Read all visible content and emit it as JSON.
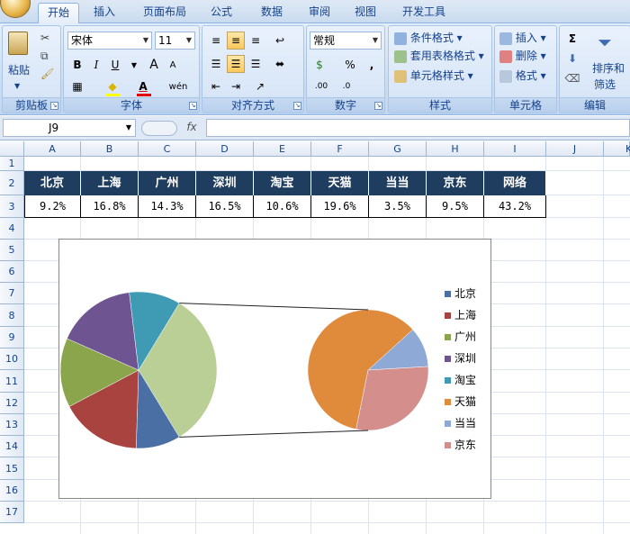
{
  "ribbon_tabs": [
    "开始",
    "插入",
    "页面布局",
    "公式",
    "数据",
    "审阅",
    "视图",
    "开发工具"
  ],
  "active_tab": "开始",
  "groups": {
    "clipboard": {
      "label": "剪贴板",
      "paste": "粘贴"
    },
    "font": {
      "label": "字体",
      "font_name": "宋体",
      "font_size": "11",
      "bold": "B",
      "italic": "I",
      "underline": "U",
      "grow": "A",
      "shrink": "A",
      "font_color": "A",
      "phonetic": "wén"
    },
    "alignment": {
      "label": "对齐方式"
    },
    "number": {
      "label": "数字",
      "format": "常规",
      "percent": "%",
      "comma": ","
    },
    "styles": {
      "label": "样式",
      "conditional": "条件格式",
      "table": "套用表格格式",
      "cell_styles": "单元格样式"
    },
    "cells": {
      "label": "单元格",
      "insert": "插入",
      "delete": "删除",
      "format": "格式"
    },
    "editing": {
      "label": "编辑",
      "sum": "Σ",
      "sort": "排序和",
      "filter": "筛选"
    }
  },
  "formula_bar": {
    "name_box": "J9",
    "fx": "fx",
    "content": ""
  },
  "columns": [
    "A",
    "B",
    "C",
    "D",
    "E",
    "F",
    "G",
    "H",
    "I",
    "J",
    "K"
  ],
  "rows": [
    "1",
    "2",
    "3",
    "4",
    "5",
    "6",
    "7",
    "8",
    "9",
    "10",
    "11",
    "12",
    "13",
    "14",
    "15",
    "16",
    "17"
  ],
  "table": {
    "headers": [
      "北京",
      "上海",
      "广州",
      "深圳",
      "淘宝",
      "天猫",
      "当当",
      "京东",
      "网络"
    ],
    "values": [
      "9.2%",
      "16.8%",
      "14.3%",
      "16.5%",
      "10.6%",
      "19.6%",
      "3.5%",
      "9.5%",
      "43.2%"
    ]
  },
  "chart_data": {
    "type": "pie",
    "subtype": "pie-of-pie",
    "categories": [
      "北京",
      "上海",
      "广州",
      "深圳",
      "淘宝",
      "天猫",
      "当当",
      "京东"
    ],
    "values": [
      9.2,
      16.8,
      14.3,
      16.5,
      10.6,
      19.6,
      3.5,
      9.5
    ],
    "colors": [
      "#4a6fa5",
      "#a8433f",
      "#8aa54b",
      "#6e5490",
      "#3f9bb3",
      "#e08a3c",
      "#8fa9d6",
      "#d48e8c"
    ],
    "secondary_plot": [
      "天猫",
      "当当",
      "京东"
    ],
    "legend_position": "right",
    "title": ""
  }
}
